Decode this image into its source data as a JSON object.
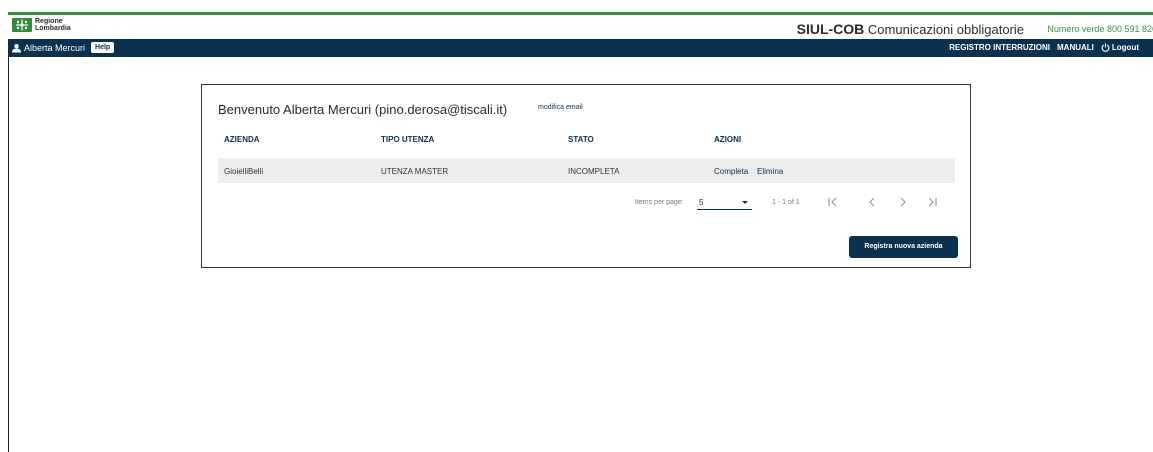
{
  "header": {
    "logo_line1": "Regione",
    "logo_line2": "Lombardia",
    "app_name": "SIUL-COB",
    "app_subtitle": "Comunicazioni obbligatorie",
    "numero_verde": "Numero verde 800 591 826",
    "accent_color": "#3a8e3e"
  },
  "navbar": {
    "user_name": "Alberta Mercuri",
    "help_label": "Help",
    "registro_label": "REGISTRO INTERRUZIONI",
    "manuali_label": "MANUALI",
    "logout_label": "Logout",
    "bg_color": "#0a3150"
  },
  "main": {
    "welcome": "Benvenuto Alberta Mercuri (pino.derosa@tiscali.it)",
    "modifica_email": "modifica email",
    "columns": [
      "AZIENDA",
      "TIPO UTENZA",
      "STATO",
      "AZIONI"
    ],
    "rows": [
      {
        "azienda": "GioielliBelli",
        "tipo_utenza": "UTENZA MASTER",
        "stato": "INCOMPLETA",
        "azioni": [
          "Completa",
          "Elimina"
        ]
      }
    ],
    "paginator": {
      "items_per_page_label": "Items per page:",
      "items_per_page_value": "5",
      "range_label": "1 - 1 of 1",
      "icons": [
        "first-page-icon",
        "prev-page-icon",
        "next-page-icon",
        "last-page-icon"
      ]
    },
    "register_button": "Registra nuova azienda"
  }
}
